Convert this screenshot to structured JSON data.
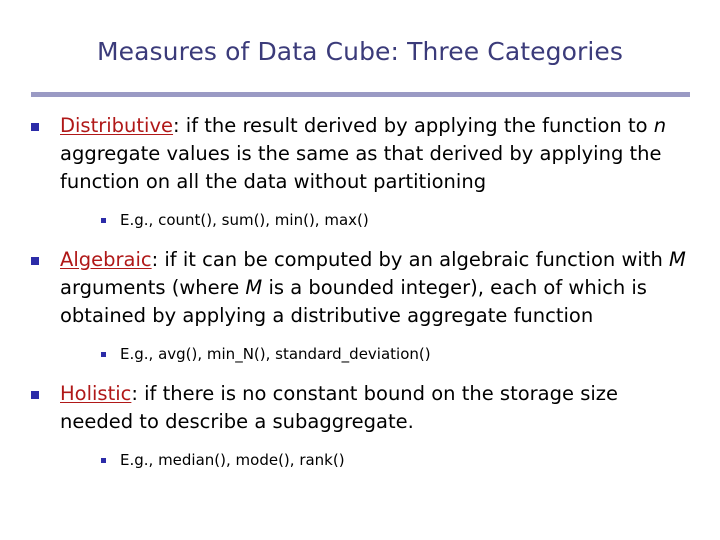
{
  "slide": {
    "title": "Measures of Data Cube: Three Categories",
    "colors": {
      "title": "#3b3b7a",
      "rule": "#9a9ac4",
      "keyword": "#b01818",
      "bullet_marker": "#2c2ca8",
      "body_text": "#000000",
      "background": "#ffffff"
    },
    "bullets": [
      {
        "keyword": "Distributive",
        "text_before_var": ": if the result derived by applying the function to ",
        "variable": "n",
        "text_after_var": " aggregate values is the same as that derived by applying the function on all the data without partitioning",
        "sub_bullet": "E.g., count(), sum(), min(), max()"
      },
      {
        "keyword": "Algebraic",
        "text_part1": ": if it can be computed by an algebraic function with ",
        "variable1": "M",
        "text_part2": " arguments (where ",
        "variable2": "M",
        "text_part3": " is a bounded integer), each of which is obtained by applying a distributive aggregate function",
        "sub_bullet": "E.g.,  avg(), min_N(), standard_deviation()"
      },
      {
        "keyword": "Holistic",
        "text": ": if there is no constant bound on the storage size needed to describe a subaggregate.",
        "sub_bullet": "E.g., median(), mode(), rank()"
      }
    ]
  }
}
